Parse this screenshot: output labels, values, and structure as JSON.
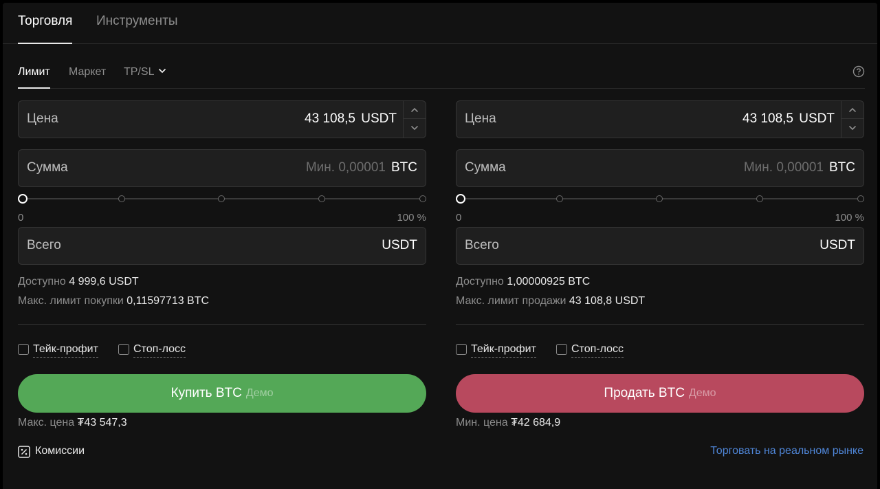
{
  "top_tabs": [
    "Торговля",
    "Инструменты"
  ],
  "order_tabs": {
    "limit": "Лимит",
    "market": "Маркет",
    "tpsl": "TP/SL"
  },
  "buy": {
    "price_label": "Цена",
    "price_value": "43 108,5",
    "price_unit": "USDT",
    "amount_label": "Сумма",
    "amount_placeholder": "Мин. 0,00001",
    "amount_unit": "BTC",
    "slider_min": "0",
    "slider_max": "100 %",
    "slider_level_percent": 0,
    "total_label": "Всего",
    "total_unit": "USDT",
    "available_label": "Доступно",
    "available_value": "4 999,6 USDT",
    "max_limit_label": "Макс. лимит покупки",
    "max_limit_value": "0,11597713 BTC",
    "take_profit": "Тейк-профит",
    "stop_loss": "Стоп-лосс",
    "button_label": "Купить BTC",
    "button_demo": "Демо",
    "limit_price_label": "Макс. цена",
    "limit_price_value": "₮43 547,3"
  },
  "sell": {
    "price_label": "Цена",
    "price_value": "43 108,5",
    "price_unit": "USDT",
    "amount_label": "Сумма",
    "amount_placeholder": "Мин. 0,00001",
    "amount_unit": "BTC",
    "slider_min": "0",
    "slider_max": "100 %",
    "slider_level_percent": 0,
    "total_label": "Всего",
    "total_unit": "USDT",
    "available_label": "Доступно",
    "available_value": "1,00000925 BTC",
    "max_limit_label": "Макс. лимит продажи",
    "max_limit_value": "43 108,8 USDT",
    "take_profit": "Тейк-профит",
    "stop_loss": "Стоп-лосс",
    "button_label": "Продать BTC",
    "button_demo": "Демо",
    "limit_price_label": "Мин. цена",
    "limit_price_value": "₮42 684,9"
  },
  "footer": {
    "fees": "Комиссии",
    "real_market_link": "Торговать на реальном рынке"
  },
  "colors": {
    "buy": "#54a857",
    "sell": "#b8495e",
    "link": "#4f86d8",
    "background": "#121212"
  }
}
